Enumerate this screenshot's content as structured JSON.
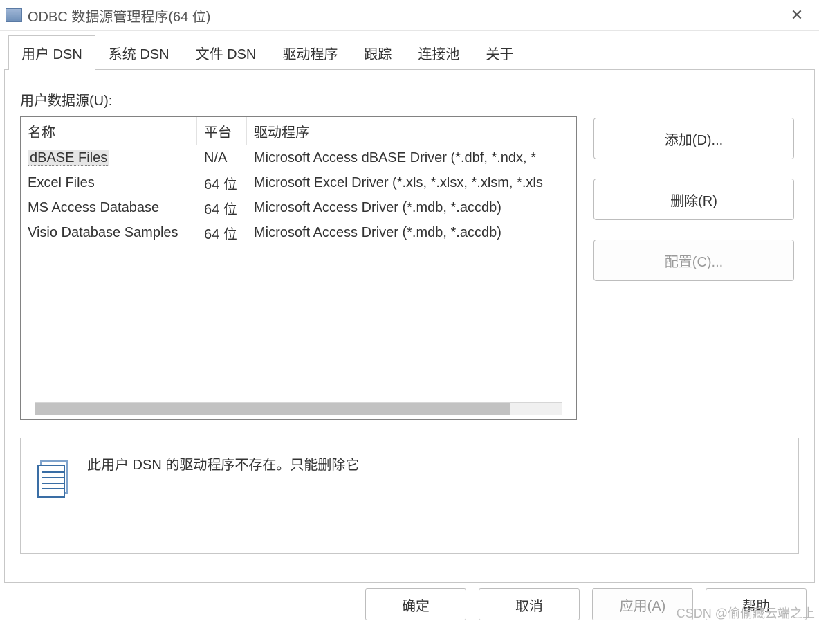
{
  "window": {
    "title": "ODBC 数据源管理程序(64 位)"
  },
  "tabs": [
    {
      "id": "user-dsn",
      "label": "用户 DSN",
      "active": true
    },
    {
      "id": "system-dsn",
      "label": "系统 DSN",
      "active": false
    },
    {
      "id": "file-dsn",
      "label": "文件 DSN",
      "active": false
    },
    {
      "id": "drivers",
      "label": "驱动程序",
      "active": false
    },
    {
      "id": "trace",
      "label": "跟踪",
      "active": false
    },
    {
      "id": "pool",
      "label": "连接池",
      "active": false
    },
    {
      "id": "about",
      "label": "关于",
      "active": false
    }
  ],
  "main": {
    "list_label": "用户数据源(U):",
    "columns": {
      "name": "名称",
      "platform": "平台",
      "driver": "驱动程序"
    },
    "rows": [
      {
        "name": "dBASE Files",
        "platform": "N/A",
        "driver": "Microsoft Access dBASE Driver (*.dbf, *.ndx, *",
        "selected": true
      },
      {
        "name": "Excel Files",
        "platform": "64 位",
        "driver": "Microsoft Excel Driver (*.xls, *.xlsx, *.xlsm, *.xls",
        "selected": false
      },
      {
        "name": "MS Access Database",
        "platform": "64 位",
        "driver": "Microsoft Access Driver (*.mdb, *.accdb)",
        "selected": false
      },
      {
        "name": "Visio Database Samples",
        "platform": "64 位",
        "driver": "Microsoft Access Driver (*.mdb, *.accdb)",
        "selected": false
      }
    ],
    "actions": {
      "add": {
        "label": "添加(D)...",
        "enabled": true
      },
      "remove": {
        "label": "删除(R)",
        "enabled": true
      },
      "configure": {
        "label": "配置(C)...",
        "enabled": false
      }
    },
    "info": "此用户 DSN 的驱动程序不存在。只能删除它"
  },
  "footer": {
    "ok": {
      "label": "确定",
      "enabled": true
    },
    "cancel": {
      "label": "取消",
      "enabled": true
    },
    "apply": {
      "label": "应用(A)",
      "enabled": false
    },
    "help": {
      "label": "帮助",
      "enabled": true
    }
  },
  "watermark": "CSDN @偷偷藏云端之上"
}
